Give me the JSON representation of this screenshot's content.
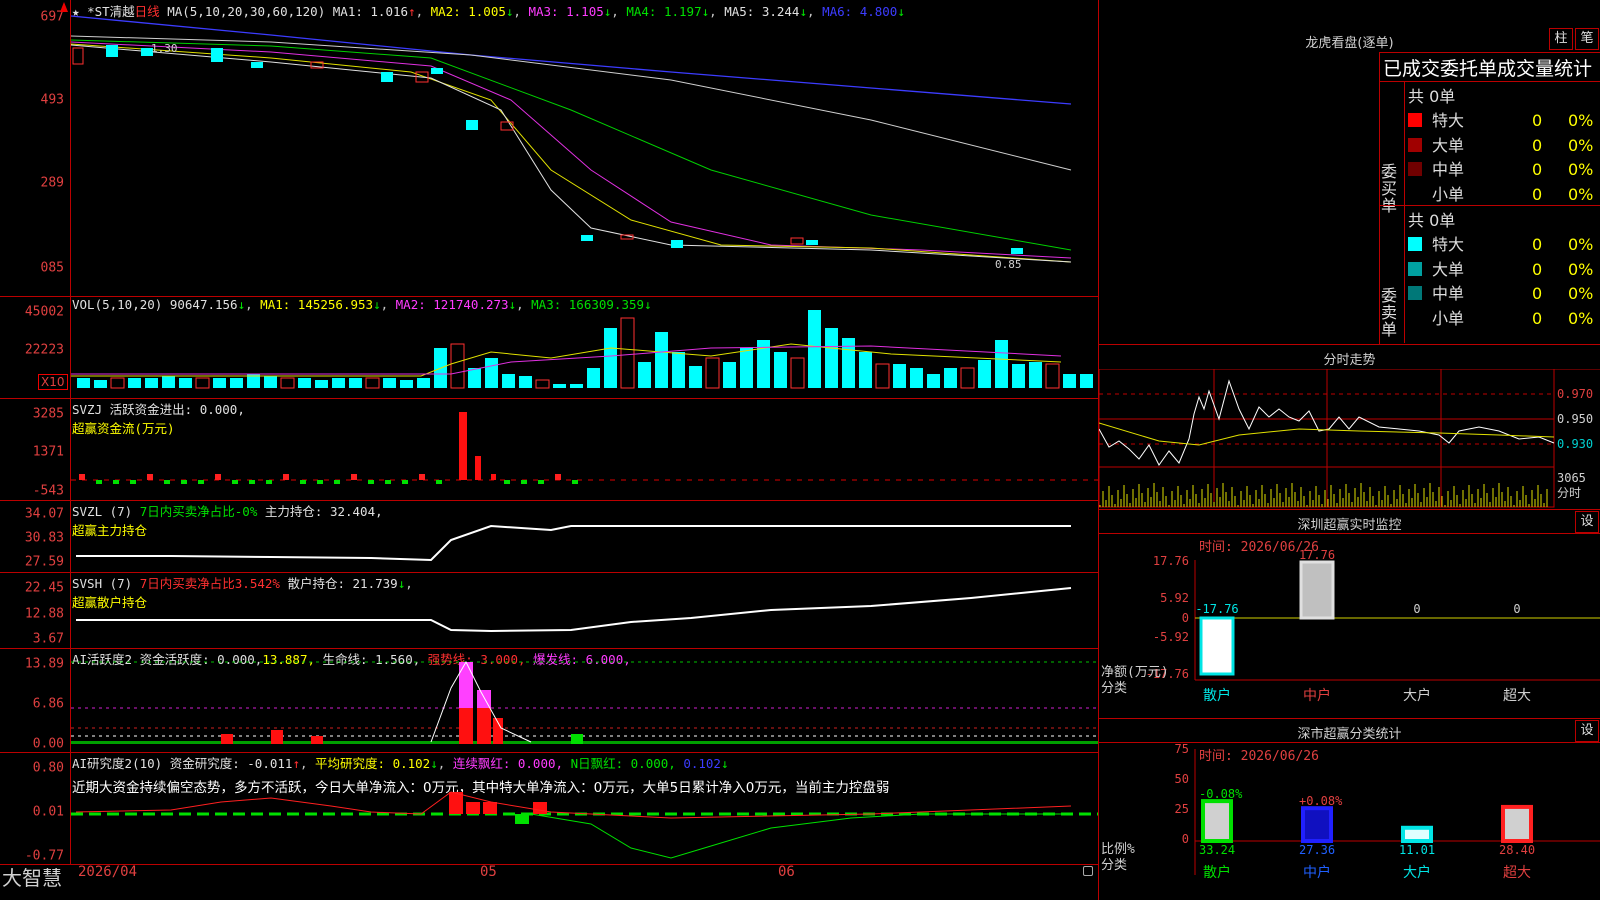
{
  "stock": {
    "star": "★",
    "name": "*ST清越",
    "period": "日线"
  },
  "price_pane": {
    "ma_label": "MA(5,10,20,30,60,120)",
    "ma1": "MA1: 1.016",
    "ma1_arrow": "↑",
    "ma2": "MA2: 1.005",
    "ma2_arrow": "↓",
    "ma3": "MA3: 1.105",
    "ma3_arrow": "↓",
    "ma4": "MA4: 1.197",
    "ma4_arrow": "↓",
    "ma5": "MA5: 3.244",
    "ma5_arrow": "↓",
    "ma6": "MA6: 4.800",
    "ma6_arrow": "↓",
    "y_ticks": [
      "697",
      "493",
      "289",
      "085"
    ],
    "hi_label": "1.30",
    "lo_label": "0.85"
  },
  "vol_pane": {
    "label": "VOL(5,10,20)",
    "value": "90647.156",
    "arrow": "↓",
    "ma1": "MA1: 145256.953",
    "ma1_arrow": "↓",
    "ma2": "MA2: 121740.273",
    "ma2_arrow": "↓",
    "ma3": "MA3: 166309.359",
    "ma3_arrow": "↓",
    "y_ticks": [
      "45002",
      "22223"
    ],
    "unit": "X10"
  },
  "svzj_pane": {
    "label": "SVZJ",
    "text": "活跃资金进出: 0.000,",
    "sub": "超赢资金流(万元)",
    "y_ticks": [
      "3285",
      "1371",
      "-543"
    ]
  },
  "svzl_pane": {
    "label": "SVZL (7)",
    "text1": "7日内买卖净占比-0%",
    "text2": "主力持仓: 32.404,",
    "sub": "超赢主力持仓",
    "y_ticks": [
      "34.07",
      "30.83",
      "27.59"
    ]
  },
  "svsh_pane": {
    "label": "SVSH (7)",
    "text1": "7日内买卖净占比3.542%",
    "text2": "散户持仓: 21.739",
    "arrow": "↓",
    "sub": "超赢散户持仓",
    "y_ticks": [
      "22.45",
      "12.88",
      "3.67"
    ]
  },
  "ai2_pane": {
    "label": "AI活跃度2",
    "t1": "资金活跃度: 0.000,",
    "t2": "13.887,",
    "t3": "生命线: 1.560,",
    "t4": "强势线: 3.000,",
    "t5": "爆发线: 6.000,",
    "y_ticks": [
      "13.89",
      "6.86",
      "0.00"
    ]
  },
  "ai_research_pane": {
    "label": "AI研究度2(10)",
    "t1": "资金研究度: -0.011",
    "a1": "↑",
    "t2": "平均研究度: 0.102",
    "a2": "↓",
    "t3": "连续飘红: 0.000,",
    "t4": "N日飘红: 0.000,",
    "t5": "0.102",
    "a5": "↓",
    "comment": "近期大资金持续偏空态势，多方不活跃，今日大单净流入：0万元，其中特大单净流入：0万元，大单5日累计净入0万元，当前主力控盘弱",
    "y_ticks": [
      "0.80",
      "0.01",
      "-0.77"
    ]
  },
  "bottom_bar": {
    "logo": "大智慧",
    "dates": [
      "2026/04",
      "05",
      "06"
    ]
  },
  "longhu": {
    "title": "龙虎看盘(逐单)",
    "btn1": "柱",
    "btn2": "笔",
    "header": "已成交委托单成交量统计",
    "buy_label": "委买单",
    "sell_label": "委卖单",
    "buy_total": "共 0单",
    "sell_total": "共 0单",
    "buy_rows": [
      {
        "name": "特大",
        "n": "0",
        "p": "0%",
        "color": "#ff0000"
      },
      {
        "name": "大单",
        "n": "0",
        "p": "0%",
        "color": "#a00000"
      },
      {
        "name": "中单",
        "n": "0",
        "p": "0%",
        "color": "#700000"
      },
      {
        "name": "小单",
        "n": "0",
        "p": "0%",
        "color": "#000000"
      }
    ],
    "sell_rows": [
      {
        "name": "特大",
        "n": "0",
        "p": "0%",
        "color": "#00ffff"
      },
      {
        "name": "大单",
        "n": "0",
        "p": "0%",
        "color": "#00a0a0"
      },
      {
        "name": "中单",
        "n": "0",
        "p": "0%",
        "color": "#007878"
      },
      {
        "name": "小单",
        "n": "0",
        "p": "0%",
        "color": "#000000"
      }
    ]
  },
  "fenshi": {
    "title": "分时走势",
    "prices": [
      "0.970",
      "0.950",
      "0.930"
    ],
    "vol": "3065",
    "vol_unit": "分时"
  },
  "monitor": {
    "title": "深圳超赢实时监控",
    "btn": "设",
    "time": "时间: 2026/06/26",
    "y_ticks": [
      "17.76",
      "5.92",
      "0",
      "-5.92",
      "-17.76"
    ],
    "ylabel": "净额(万元)",
    "xlabel": "分类",
    "categories": [
      "散户",
      "中户",
      "大户",
      "超大"
    ],
    "value_labels": [
      "-17.76",
      "17.76",
      "0",
      "0"
    ]
  },
  "stats": {
    "title": "深市超赢分类统计",
    "btn": "设",
    "time": "时间: 2026/06/26",
    "y_ticks": [
      "75",
      "50",
      "25",
      "0"
    ],
    "ylabel": "比例%",
    "xlabel": "分类",
    "categories": [
      "散户",
      "中户",
      "大户",
      "超大"
    ],
    "values": [
      "33.24",
      "27.36",
      "11.01",
      "28.40"
    ],
    "deltas": [
      "-0.08%",
      "+0.08%"
    ]
  },
  "chart_data": [
    {
      "type": "bar",
      "title": "深圳超赢实时监控",
      "categories": [
        "散户",
        "中户",
        "大户",
        "超大"
      ],
      "values": [
        -17.76,
        17.76,
        0,
        0
      ],
      "ylabel": "净额(万元)",
      "ylim": [
        -17.76,
        17.76
      ]
    },
    {
      "type": "bar",
      "title": "深市超赢分类统计",
      "categories": [
        "散户",
        "中户",
        "大户",
        "超大"
      ],
      "values": [
        33.24,
        27.36,
        11.01,
        28.4
      ],
      "ylabel": "比例%",
      "ylim": [
        0,
        75
      ]
    }
  ]
}
